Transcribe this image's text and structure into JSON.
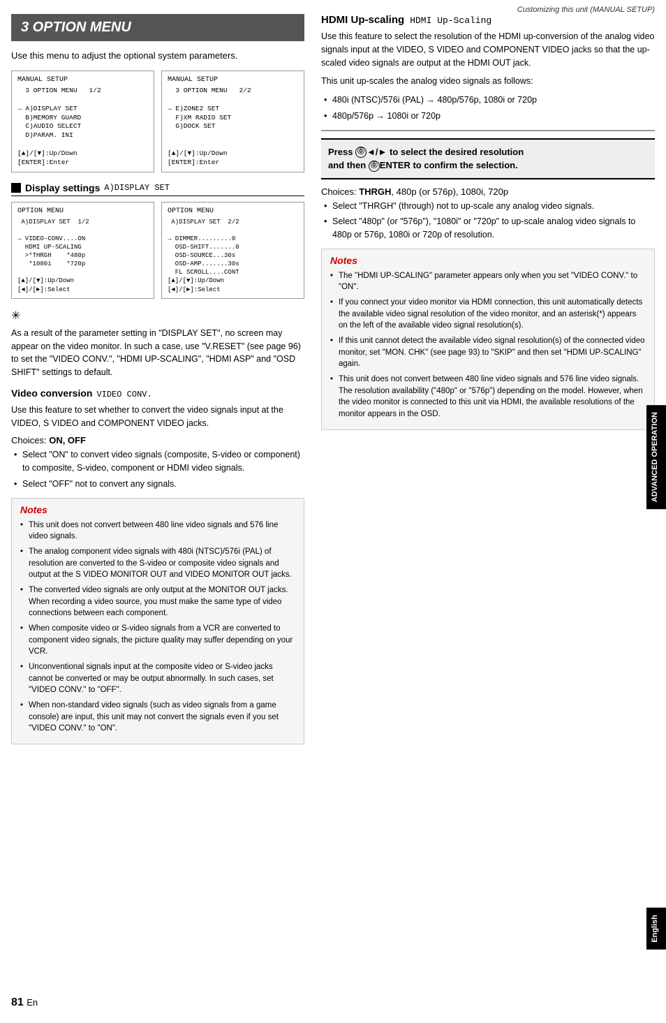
{
  "page_header": "Customizing this unit (MANUAL SETUP)",
  "section_title": "3 OPTION MENU",
  "section_intro": "Use this menu to adjust the optional system parameters.",
  "screen_boxes_top": [
    {
      "title": "MANUAL SETUP",
      "lines": [
        "  3 OPTION MENU   1/2",
        "",
        "→ A)DISPLAY SET",
        "  B)MEMORY GUARD",
        "  C)AUDIO SELECT",
        "  D)PARAM. INI",
        "",
        "[▲]/[▼]:Up/Down",
        "[ENTER]:Enter"
      ]
    },
    {
      "title": "MANUAL SETUP",
      "lines": [
        "  3 OPTION MENU   2/2",
        "",
        "→ E)ZONE2 SET",
        "  F)XM RADIO SET",
        "  G)DOCK SET",
        "",
        "",
        "[▲]/[▼]:Up/Down",
        "[ENTER]:Enter"
      ]
    }
  ],
  "display_settings": {
    "label": "Display settings",
    "mono": "A)DISPLAY SET",
    "screen_boxes": [
      {
        "title": "OPTION MENU",
        "lines": [
          " A)DISPLAY SET  1/2",
          "",
          "→ VIDEO-CONV....ON",
          "  HDMI UP-SCALING",
          "  >*THRGH    *480p",
          "   *1080i    *720p",
          "",
          "[▲]/[▼]:Up/Down",
          "[◄]/[►]:Select"
        ]
      },
      {
        "title": "OPTION MENU",
        "lines": [
          " A)DISPLAY SET  2/2",
          "",
          "→ DIMMER.........0",
          "  OSD-SHIFT.......0",
          "  OSD-SOURCE...30s",
          "  OSD-AMP.......30s",
          "  FL SCROLL....CONT",
          "[▲]/[▼]:Up/Down",
          "[◄]/[►]:Select"
        ]
      }
    ],
    "tip_icon": "✳",
    "tip_text": "As a result of the parameter setting in \"DISPLAY SET\", no screen may appear on the video monitor. In such a case, use \"V.RESET\" (see page 96) to set the \"VIDEO CONV.\", \"HDMI UP-SCALING\", \"HDMI ASP\" and \"OSD SHIFT\" settings to default."
  },
  "video_conversion": {
    "label": "Video conversion",
    "mono": "VIDEO CONV.",
    "intro": "Use this feature to set whether to convert the video signals input at the VIDEO, S VIDEO and COMPONENT VIDEO jacks.",
    "choices_label": "Choices:",
    "choices": "ON, OFF",
    "bullets": [
      "Select \"ON\" to convert video signals (composite, S-video or component) to composite, S-video, component or HDMI video signals.",
      "Select \"OFF\" not to convert any signals."
    ],
    "notes_title": "Notes",
    "notes": [
      "This unit does not convert between 480 line video signals and 576 line video signals.",
      "The analog component video signals with 480i (NTSC)/576i (PAL) of resolution are converted to the S-video or composite video signals and output at the S VIDEO MONITOR OUT and VIDEO MONITOR OUT jacks.",
      "The converted video signals are only output at the MONITOR OUT jacks. When recording a video source, you must make the same type of video connections between each component.",
      "When composite video or S-video signals from a VCR are converted to component video signals, the picture quality may suffer depending on your VCR.",
      "Unconventional signals input at the composite video or S-video jacks cannot be converted or may be output abnormally. In such cases, set \"VIDEO CONV.\" to \"OFF\".",
      "When non-standard video signals (such as video signals from a game console) are input, this unit may not convert the signals even if you set \"VIDEO CONV.\" to \"ON\"."
    ]
  },
  "hdmi_upscaling": {
    "label": "HDMI Up-scaling",
    "mono": "HDMI Up-Scaling",
    "intro": "Use this feature to select the resolution of the HDMI up-conversion of the analog video signals input at the VIDEO, S VIDEO and COMPONENT VIDEO jacks so that the up-scaled video signals are output at the HDMI OUT jack.",
    "upscale_intro": "This unit up-scales the analog video signals as follows:",
    "upscale_bullets": [
      "480i (NTSC)/576i (PAL) → 480p/576p, 1080i or 720p",
      "480p/576p → 1080i or 720p"
    ],
    "press_instruction": "Press ⓪◄/► to select the desired resolution and then ⓪ENTER to confirm the selection.",
    "choices_label": "Choices:",
    "choices_bold": "THRGH",
    "choices_rest": ", 480p (or 576p), 1080i, 720p",
    "choice_bullets": [
      "Select \"THRGH\" (through) not to up-scale any analog video signals.",
      "Select \"480p\" (or \"576p\"), \"1080i\" or \"720p\" to up-scale analog video signals to 480p or 576p, 1080i or 720p of resolution."
    ],
    "notes_title": "Notes",
    "notes": [
      "The \"HDMI UP-SCALING\" parameter appears only when you set \"VIDEO CONV.\" to \"ON\".",
      "If you connect your video monitor via HDMI connection, this unit automatically detects the available video signal resolution of the video monitor, and an asterisk(*) appears on the left of the available video signal resolution(s).",
      "If this unit cannot detect the available video signal resolution(s) of the connected video monitor, set \"MON. CHK\" (see page 93) to \"SKIP\" and then set \"HDMI UP-SCALING\" again.",
      "This unit does not convert between 480 line video signals and 576 line video signals. The resolution availability (\"480p\" or \"576p\") depending on the model. However, when the video monitor is connected to this unit via HDMI, the available resolutions of the monitor appears in the OSD."
    ]
  },
  "side_tab": {
    "advanced": "ADVANCED OPERATION",
    "english": "English"
  },
  "page_number": "81",
  "page_suffix": "En"
}
